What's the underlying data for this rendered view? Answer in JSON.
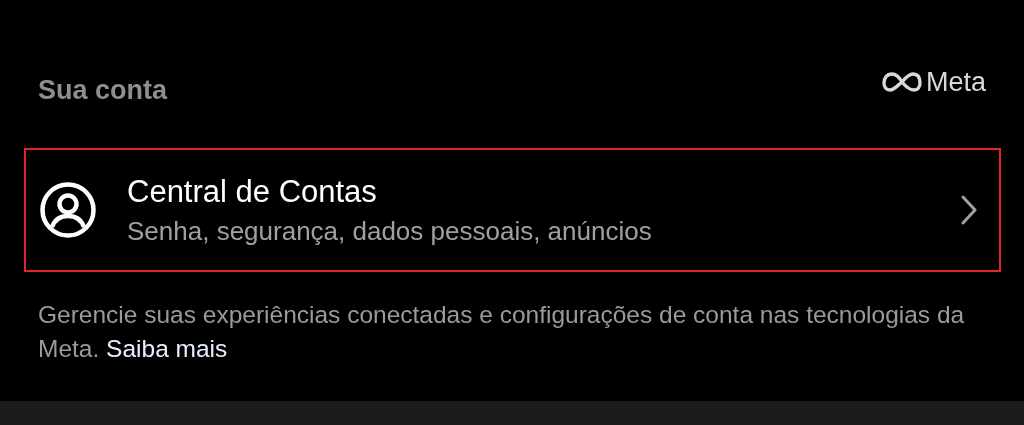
{
  "header": {
    "title": "Sua conta",
    "brand": "Meta"
  },
  "item": {
    "title": "Central de Contas",
    "subtitle": "Senha, segurança, dados pessoais, anúncios",
    "highlighted": true
  },
  "footer": {
    "text": "Gerencie suas experiências conectadas e configurações de conta nas tecnologias da Meta.",
    "link": "Saiba mais"
  }
}
